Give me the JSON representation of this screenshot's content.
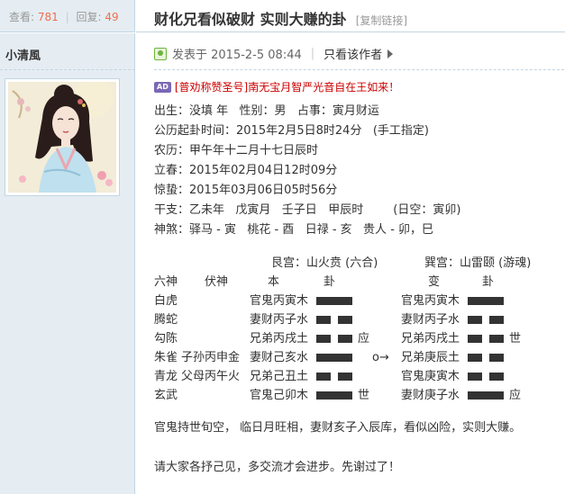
{
  "stats": {
    "views_label": "查看:",
    "views": "781",
    "replies_label": "回复:",
    "replies": "49"
  },
  "thread": {
    "title": "财化兄看似破财 实则大赚的卦",
    "copy_link": "[复制链接]"
  },
  "author": {
    "name": "小清風"
  },
  "post": {
    "posted": "发表于 2015-2-5 08:44",
    "author_only": "只看该作者"
  },
  "ad": {
    "badge": "AD",
    "text": "[普劝称赞圣号]南无宝月智严光音自在王如来！"
  },
  "details": {
    "l1": "出生：没填 年   性别：男   占事：寅月财运",
    "l2": "公历起卦时间：2015年2月5日8时24分   (手工指定)",
    "l3": "农历：甲午年十二月十七日辰时",
    "l4": "立春：2015年02月04日12时09分",
    "l5": "惊蛰：2015年03月06日05时56分",
    "l6": "干支：乙未年   戊寅月   壬子日   甲辰时        (日空：寅卯)",
    "l7": "神煞：驿马 - 寅   桃花 - 酉   日禄 - 亥   贵人 - 卯，巳"
  },
  "gua": {
    "header_ben": "艮宫：山火贲 (六合)",
    "header_bian": "巽宫：山雷颐 (游魂)",
    "col_liushen": "六神",
    "col_fushen": "伏神",
    "col_ben": "本",
    "col_gua1": "卦",
    "col_bian": "变",
    "col_gua2": "卦",
    "rows": [
      {
        "shen": "白虎",
        "fu": "",
        "ben": "官鬼丙寅木",
        "shi": "",
        "move": "",
        "bian": "官鬼丙寅木",
        "bshi": ""
      },
      {
        "shen": "腾蛇",
        "fu": "",
        "ben": "妻财丙子水",
        "shi": "",
        "move": "",
        "bian": "妻财丙子水",
        "bshi": ""
      },
      {
        "shen": "勾陈",
        "fu": "",
        "ben": "兄弟丙戌土",
        "shi": "应",
        "move": "",
        "bian": "兄弟丙戌土",
        "bshi": "世"
      },
      {
        "shen": "朱雀",
        "fu": "子孙丙申金",
        "ben": "妻财己亥水",
        "shi": "",
        "move": "o→",
        "bian": "兄弟庚辰土",
        "bshi": ""
      },
      {
        "shen": "青龙",
        "fu": "父母丙午火",
        "ben": "兄弟己丑土",
        "shi": "",
        "move": "",
        "bian": "官鬼庚寅木",
        "bshi": ""
      },
      {
        "shen": "玄武",
        "fu": "",
        "ben": "官鬼己卯木",
        "shi": "世",
        "move": "",
        "bian": "妻财庚子水",
        "bshi": "应"
      }
    ]
  },
  "conclusion": "官鬼持世旬空，  临日月旺相，妻财亥子入辰库，看似凶险，实则大赚。",
  "thanks": "请大家各抒己见，多交流才会进步。先谢过了！"
}
